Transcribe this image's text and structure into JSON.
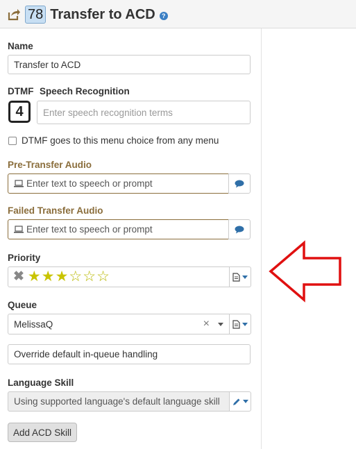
{
  "header": {
    "menu_number": "78",
    "title": "Transfer to ACD"
  },
  "name": {
    "label": "Name",
    "value": "Transfer to ACD"
  },
  "dtmf": {
    "label": "DTMF",
    "key": "4"
  },
  "speech": {
    "label": "Speech Recognition",
    "placeholder": "Enter speech recognition terms"
  },
  "any_menu": {
    "label": "DTMF goes to this menu choice from any menu",
    "checked": false
  },
  "pre_transfer_audio": {
    "label": "Pre-Transfer Audio",
    "placeholder": "Enter text to speech or prompt"
  },
  "failed_transfer_audio": {
    "label": "Failed Transfer Audio",
    "placeholder": "Enter text to speech or prompt"
  },
  "priority": {
    "label": "Priority",
    "rating": 3,
    "max": 6
  },
  "queue": {
    "label": "Queue",
    "value": "MelissaQ",
    "clear": "×"
  },
  "override": {
    "value": "Override default in-queue handling"
  },
  "language_skill": {
    "label": "Language Skill",
    "value": "Using supported language's default language skill"
  },
  "add_skill": {
    "label": "Add ACD Skill"
  },
  "colors": {
    "accent_blue": "#3b7fc4",
    "warning_brown": "#8a6d3b",
    "star_yellow": "#c9c400",
    "annotation_red": "#e01010"
  }
}
